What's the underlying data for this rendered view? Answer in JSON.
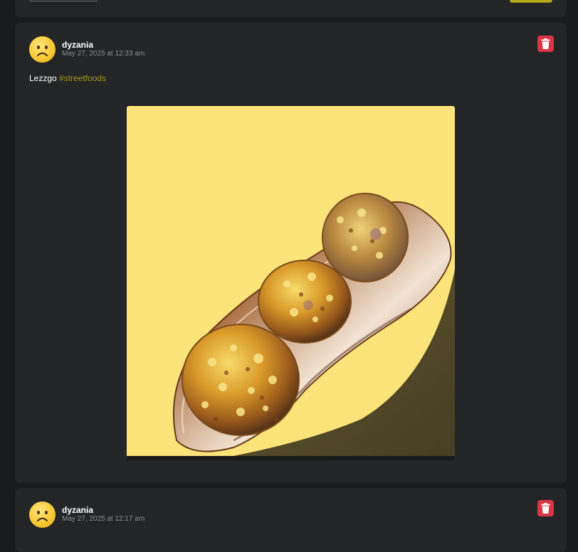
{
  "posts": [
    {
      "username": "dyzania",
      "timestamp": "May 27, 2025 at 12:33 am",
      "text": "Lezzgo",
      "hashtag": "#streetfoods",
      "image_subject": "street food balls in a foil tray on yellow background",
      "avatar_icon": "frowning-face-icon",
      "delete_icon": "trash-icon"
    },
    {
      "username": "dyzania",
      "timestamp": "May 27, 2025 at 12:17 am",
      "avatar_icon": "frowning-face-icon",
      "delete_icon": "trash-icon"
    }
  ],
  "colors": {
    "page_bg": "#1a1b1c",
    "card_bg": "#242526",
    "delete": "#dc3545",
    "hashtag": "#a39a1b",
    "accent_button": "#b5aa1a"
  }
}
